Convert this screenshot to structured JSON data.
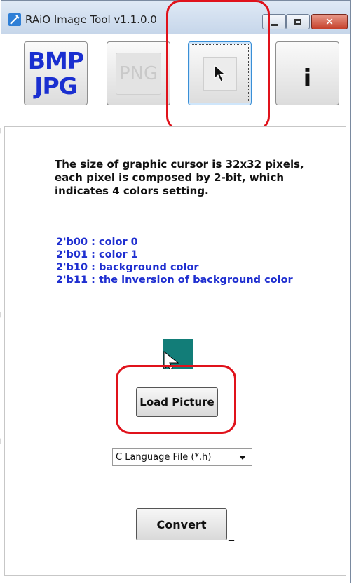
{
  "window": {
    "title": "RAiO Image Tool v1.1.0.0",
    "close_glyph": "✕"
  },
  "toolbar": {
    "bmp_line1": "BMP",
    "bmp_line2": "JPG",
    "png_label": "PNG",
    "info_label": "i",
    "active_tool": "cursor"
  },
  "description": {
    "text": "The size of graphic cursor is 32x32 pixels, each pixel is composed by 2-bit, which indicates 4 colors setting."
  },
  "color_codes": [
    "2'b00 : color 0",
    "2'b01 : color 1",
    "2'b10 : background color",
    "2'b11 : the inversion of background color"
  ],
  "actions": {
    "load_label": "Load Picture",
    "convert_label": "Convert",
    "convert_suffix": "_"
  },
  "output_format": {
    "selected": "C Language File (*.h)"
  },
  "colors": {
    "highlight": "#e0121b",
    "code_text": "#1f2fd0",
    "preview_bg": "#127d78",
    "bmp_text": "#1a2fd0"
  }
}
